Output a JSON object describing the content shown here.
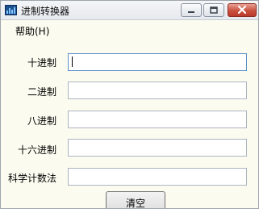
{
  "window": {
    "title": "进制转换器",
    "app_icon": "calculator-app-icon",
    "controls": [
      "minimize-icon",
      "maximize-icon",
      "close-icon"
    ]
  },
  "menu": {
    "items": [
      {
        "label": "帮助(H)"
      }
    ]
  },
  "fields": [
    {
      "label": "十进制",
      "value": "",
      "placeholder": ""
    },
    {
      "label": "二进制",
      "value": "",
      "placeholder": ""
    },
    {
      "label": "八进制",
      "value": "",
      "placeholder": ""
    },
    {
      "label": "十六进制",
      "value": "",
      "placeholder": ""
    },
    {
      "label": "科学计数法",
      "value": "",
      "placeholder": ""
    }
  ],
  "actions": {
    "clear_label": "清空"
  },
  "colors": {
    "window_background": "#fbfbf0",
    "close_button": "#c9503f",
    "focus_border": "#5b8fc9"
  }
}
